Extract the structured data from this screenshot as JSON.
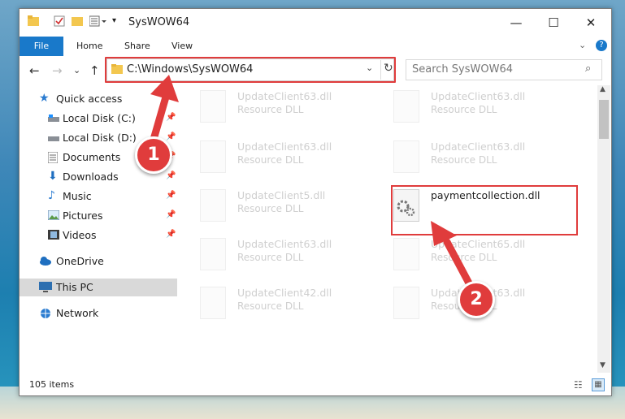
{
  "window": {
    "title": "SysWOW64",
    "controls": {
      "minimize": "—",
      "maximize": "☐",
      "close": "✕"
    }
  },
  "ribbon": {
    "tabs": [
      {
        "label": "File"
      },
      {
        "label": "Home"
      },
      {
        "label": "Share"
      },
      {
        "label": "View"
      }
    ]
  },
  "address": {
    "path": "C:\\Windows\\SysWOW64",
    "search_placeholder": "Search SysWOW64"
  },
  "nav": {
    "items": [
      {
        "label": "Quick access"
      },
      {
        "label": "Local Disk (C:)"
      },
      {
        "label": "Local Disk (D:)"
      },
      {
        "label": "Documents"
      },
      {
        "label": "Downloads"
      },
      {
        "label": "Music"
      },
      {
        "label": "Pictures"
      },
      {
        "label": "Videos"
      },
      {
        "label": "OneDrive"
      },
      {
        "label": "This PC"
      },
      {
        "label": "Network"
      }
    ]
  },
  "files": [
    {
      "name": "UpdateClient63.dll",
      "type": "Resource DLL"
    },
    {
      "name": "UpdateClient63.dll",
      "type": "Resource DLL"
    },
    {
      "name": "UpdateClient63.dll",
      "type": "Resource DLL"
    },
    {
      "name": "UpdateClient63.dll",
      "type": "Resource DLL"
    },
    {
      "name": "UpdateClient5.dll",
      "type": "Resource DLL"
    },
    {
      "name": "paymentcollection.dll",
      "type": ""
    },
    {
      "name": "UpdateClient63.dll",
      "type": "Resource DLL"
    },
    {
      "name": "UpdateClient65.dll",
      "type": "Resource DLL"
    },
    {
      "name": "UpdateClient42.dll",
      "type": "Resource DLL"
    },
    {
      "name": "UpdateClient63.dll",
      "type": "Resource DLL"
    }
  ],
  "status": {
    "count": "105 items"
  },
  "callouts": [
    {
      "label": "1"
    },
    {
      "label": "2"
    }
  ],
  "colors": {
    "accent": "#1979ca",
    "highlight": "#e03c3c"
  }
}
